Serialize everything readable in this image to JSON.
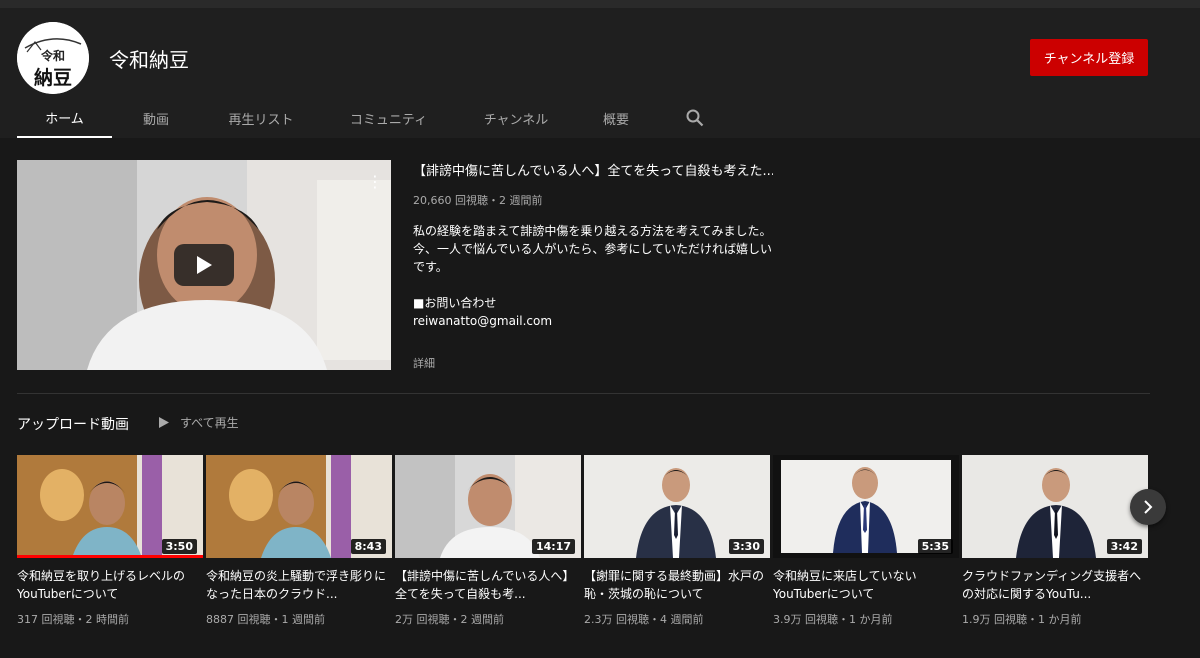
{
  "channel": {
    "name": "令和納豆",
    "avatar_text_top": "令和",
    "avatar_text_bottom": "納豆",
    "subscribe_label": "チャンネル登録"
  },
  "tabs": [
    {
      "label": "ホーム",
      "active": true
    },
    {
      "label": "動画"
    },
    {
      "label": "再生リスト"
    },
    {
      "label": "コミュニティ"
    },
    {
      "label": "チャンネル"
    },
    {
      "label": "概要"
    }
  ],
  "featured": {
    "title": "【誹謗中傷に苦しんでいる人へ】全てを失って自殺も考えた...",
    "meta": "20,660 回視聴・2 週間前",
    "description": [
      "私の経験を踏まえて誹謗中傷を乗り越える方法を考えてみました。",
      "今、一人で悩んでいる人がいたら、参考にしていただければ嬉しいです。",
      "",
      "■お問い合わせ",
      "reiwanatto@gmail.com"
    ],
    "more_label": "詳細"
  },
  "uploads": {
    "title": "アップロード動画",
    "play_all_label": "すべて再生",
    "videos": [
      {
        "title": "令和納豆を取り上げるレベルのYouTuberについて",
        "meta": "317 回視聴・2 時間前",
        "duration": "3:50",
        "watched_fraction": 1.0
      },
      {
        "title": "令和納豆の炎上騒動で浮き彫りになった日本のクラウド...",
        "meta": "8887 回視聴・1 週間前",
        "duration": "8:43"
      },
      {
        "title": "【誹謗中傷に苦しんでいる人へ】全てを失って自殺も考...",
        "meta": "2万 回視聴・2 週間前",
        "duration": "14:17"
      },
      {
        "title": "【謝罪に関する最終動画】水戸の恥・茨城の恥について",
        "meta": "2.3万 回視聴・4 週間前",
        "duration": "3:30"
      },
      {
        "title": "令和納豆に来店していないYouTuberについて",
        "meta": "3.9万 回視聴・1 か月前",
        "duration": "5:35"
      },
      {
        "title": "クラウドファンディング支援者への対応に関するYouTu...",
        "meta": "1.9万 回視聴・1 か月前",
        "duration": "3:42"
      }
    ]
  },
  "colors": {
    "background": "#181818",
    "header": "#1f1f1f",
    "subscribe": "#cc0000",
    "progress": "#ff0000",
    "secondary_text": "#aaaaaa"
  }
}
